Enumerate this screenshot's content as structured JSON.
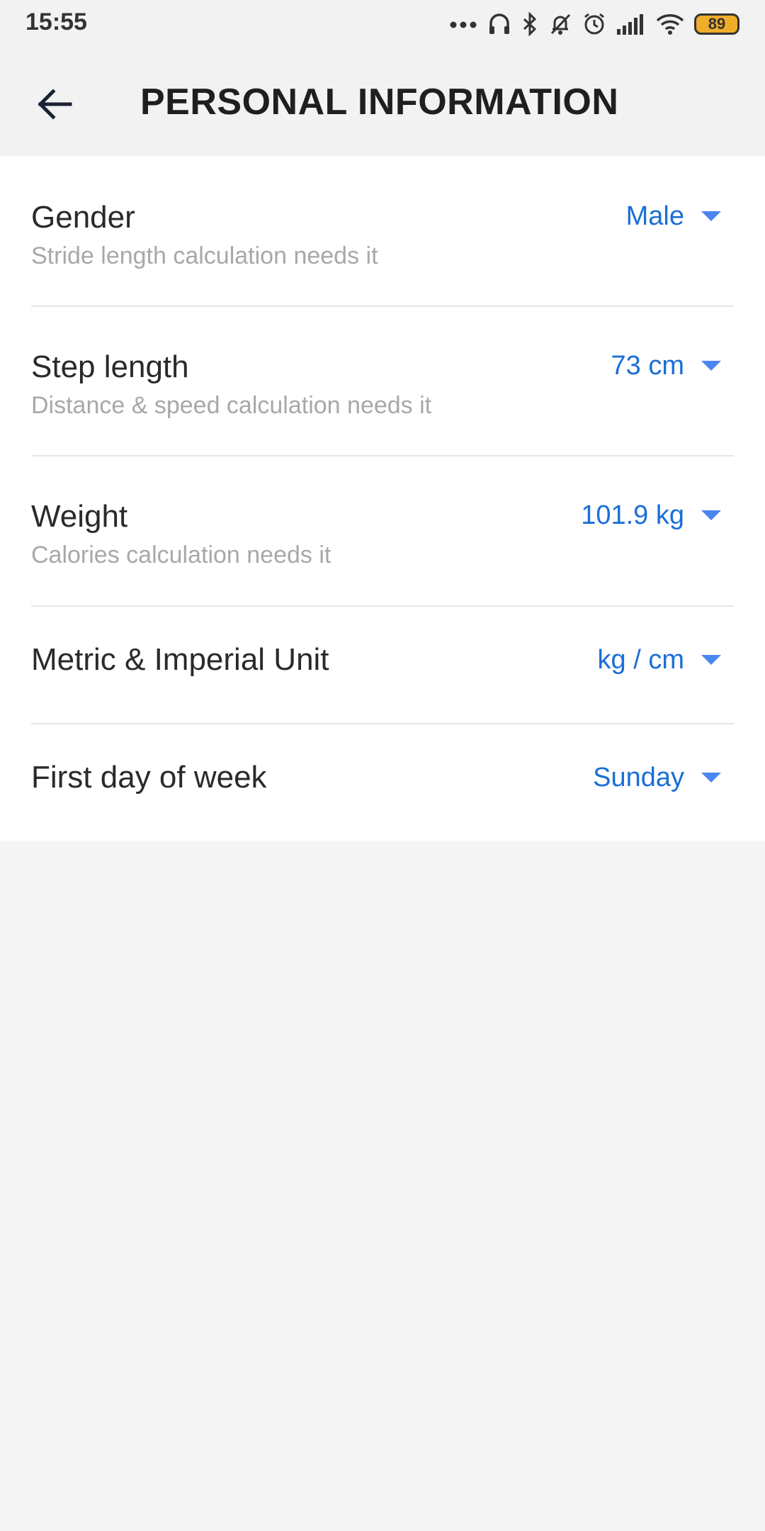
{
  "status_bar": {
    "time": "15:55",
    "battery_level": "89",
    "icons": [
      "more-dots-icon",
      "headphones-icon",
      "bluetooth-icon",
      "mute-icon",
      "alarm-icon",
      "signal-icon",
      "wifi-icon",
      "battery-icon"
    ]
  },
  "header": {
    "title": "PERSONAL INFORMATION",
    "back_icon": "arrow-left-icon"
  },
  "settings": [
    {
      "title": "Gender",
      "subtitle": "Stride length calculation needs it",
      "value": "Male"
    },
    {
      "title": "Step length",
      "subtitle": "Distance & speed calculation needs it",
      "value": "73 cm"
    },
    {
      "title": "Weight",
      "subtitle": "Calories calculation needs it",
      "value": "101.9 kg"
    },
    {
      "title": "Metric & Imperial Unit",
      "subtitle": "",
      "value": "kg / cm"
    },
    {
      "title": "First day of week",
      "subtitle": "",
      "value": "Sunday"
    }
  ],
  "colors": {
    "accent": "#1a6fd6",
    "caret": "#4a86f0",
    "title_text": "#2a2a2a",
    "subtitle_text": "#a8a8a8",
    "background": "#f5f5f5",
    "card": "#ffffff",
    "battery": "#f0ad2a"
  }
}
